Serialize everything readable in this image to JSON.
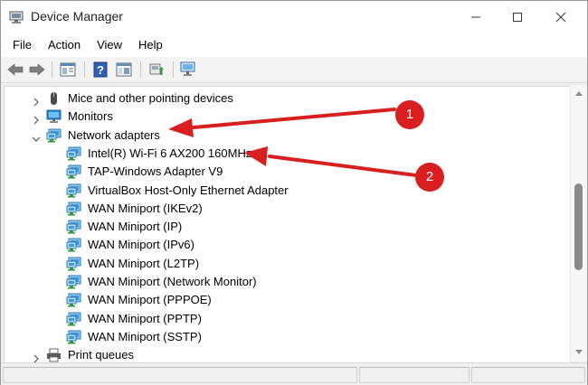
{
  "window": {
    "title": "Device Manager"
  },
  "menu": [
    "File",
    "Action",
    "View",
    "Help"
  ],
  "toolbar": {
    "buttons": [
      "back-icon",
      "forward-icon",
      "properties-panel-icon",
      "help-icon",
      "show-hide-console-icon",
      "update-driver-icon",
      "scan-hardware-icon"
    ]
  },
  "tree": {
    "items": [
      {
        "label": "Mice and other pointing devices",
        "level": 0,
        "expanded": false,
        "icon": "mouse-icon"
      },
      {
        "label": "Monitors",
        "level": 0,
        "expanded": false,
        "icon": "monitor-icon"
      },
      {
        "label": "Network adapters",
        "level": 0,
        "expanded": true,
        "icon": "network-adapter-icon"
      },
      {
        "label": "Intel(R) Wi-Fi 6 AX200 160MHz",
        "level": 1,
        "icon": "network-adapter-icon"
      },
      {
        "label": "TAP-Windows Adapter V9",
        "level": 1,
        "icon": "network-adapter-icon"
      },
      {
        "label": "VirtualBox Host-Only Ethernet Adapter",
        "level": 1,
        "icon": "network-adapter-icon"
      },
      {
        "label": "WAN Miniport (IKEv2)",
        "level": 1,
        "icon": "network-adapter-icon"
      },
      {
        "label": "WAN Miniport (IP)",
        "level": 1,
        "icon": "network-adapter-icon"
      },
      {
        "label": "WAN Miniport (IPv6)",
        "level": 1,
        "icon": "network-adapter-icon"
      },
      {
        "label": "WAN Miniport (L2TP)",
        "level": 1,
        "icon": "network-adapter-icon"
      },
      {
        "label": "WAN Miniport (Network Monitor)",
        "level": 1,
        "icon": "network-adapter-icon"
      },
      {
        "label": "WAN Miniport (PPPOE)",
        "level": 1,
        "icon": "network-adapter-icon"
      },
      {
        "label": "WAN Miniport (PPTP)",
        "level": 1,
        "icon": "network-adapter-icon"
      },
      {
        "label": "WAN Miniport (SSTP)",
        "level": 1,
        "icon": "network-adapter-icon"
      },
      {
        "label": "Print queues",
        "level": 0,
        "expanded": false,
        "icon": "printer-icon"
      }
    ]
  },
  "annotations": {
    "badge1": "1",
    "badge2": "2",
    "color": "#d81e1e"
  }
}
